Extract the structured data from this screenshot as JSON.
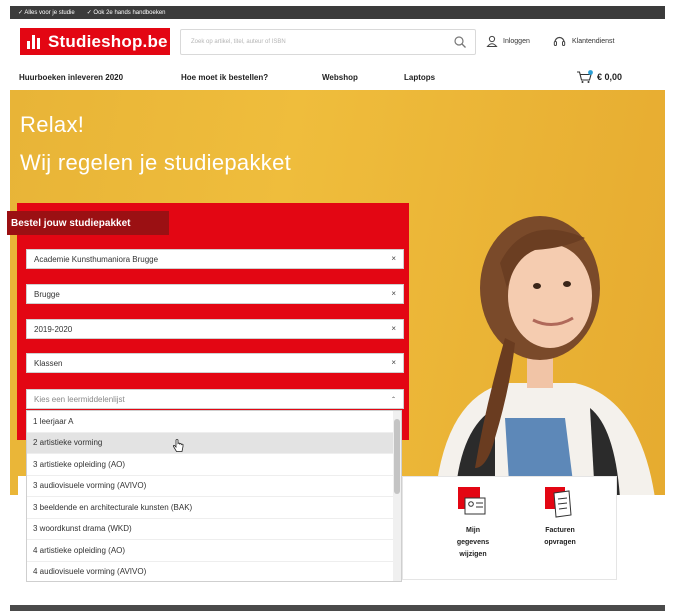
{
  "topbar": {
    "items": [
      "✓ Alles voor je studie",
      "✓ Ook 2e hands handboeken"
    ]
  },
  "header": {
    "logo_text": "Studieshop.be",
    "search_placeholder": "Zoek op artikel, titel, auteur of ISBN",
    "login_label": "Inloggen",
    "service_label": "Klantendienst"
  },
  "nav": {
    "items": [
      "Huurboeken inleveren 2020",
      "Hoe moet ik bestellen?",
      "Webshop",
      "Laptops"
    ],
    "cart_total": "€ 0,00"
  },
  "hero": {
    "line1": "Relax!",
    "line2": "Wij regelen je studiepakket"
  },
  "order_panel": {
    "title": "Bestel jouw studiepakket",
    "school": "Academie Kunsthumaniora Brugge",
    "city": "Brugge",
    "year": "2019-2020",
    "class": "Klassen",
    "list_placeholder": "Kies een leermiddelenlijst",
    "options": [
      "1 leerjaar A",
      "2 artistieke vorming",
      "3 artistieke opleiding (AO)",
      "3 audiovisuele vorming (AVIVO)",
      "3 beeldende en architecturale kunsten (BAK)",
      "3 woordkunst drama (WKD)",
      "4 artistieke opleiding (AO)",
      "4 audiovisuele vorming (AVIVO)"
    ],
    "hovered_option_index": 1
  },
  "tiles": {
    "profile_label_1": "Mijn",
    "profile_label_2": "gegevens",
    "profile_label_3": "wijzigen",
    "invoices_label_1": "Facturen",
    "invoices_label_2": "opvragen"
  },
  "colors": {
    "brand_red": "#e30613",
    "dark_red": "#9b1013",
    "hero_yellow": "#efbd3c",
    "topbar": "#3b3b3b"
  }
}
